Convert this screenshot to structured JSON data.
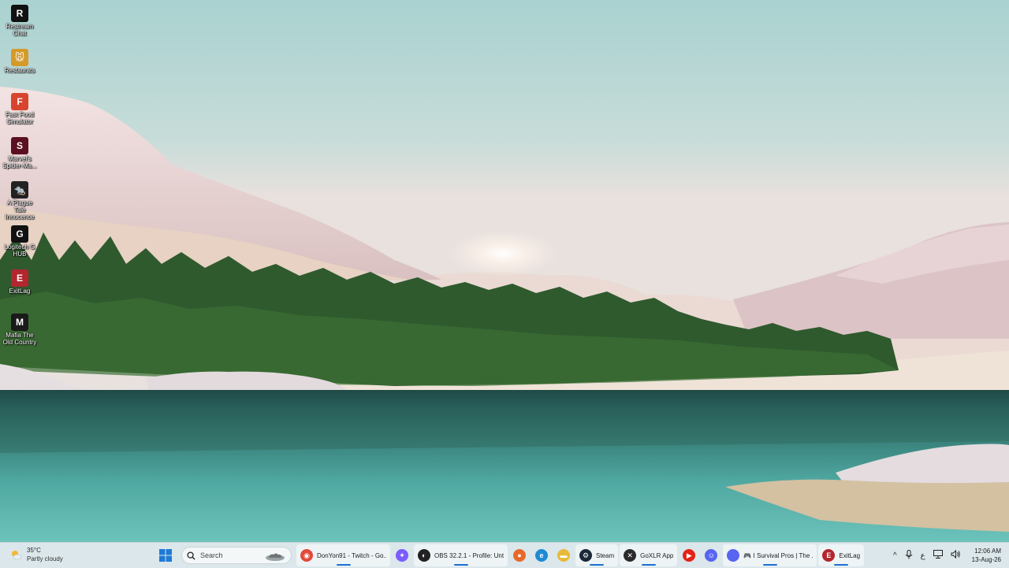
{
  "desktop": {
    "icons": [
      {
        "label": "Restream Chat",
        "icon": "restream-icon",
        "color": "#111111",
        "glyph": "R"
      },
      {
        "label": "Restaurats",
        "icon": "restaurats-icon",
        "color": "#d49a2a",
        "glyph": "🐭"
      },
      {
        "label": "Fast Food Simulator",
        "icon": "fast-food-simulator-icon",
        "color": "#d8452f",
        "glyph": "F"
      },
      {
        "label": "Marvel's Spider-Ma...",
        "icon": "spider-man-icon",
        "color": "#5a1020",
        "glyph": "S"
      },
      {
        "label": "A Plague Tale Innocence",
        "icon": "plague-tale-icon",
        "color": "#222222",
        "glyph": "🐀"
      },
      {
        "label": "Logitech G HUB",
        "icon": "logitech-ghub-icon",
        "color": "#111111",
        "glyph": "G"
      },
      {
        "label": "ExitLag",
        "icon": "exitlag-icon",
        "color": "#b3262d",
        "glyph": "E"
      },
      {
        "label": "Mafia The Old Country",
        "icon": "mafia-icon",
        "color": "#1a1a1a",
        "glyph": "M"
      }
    ]
  },
  "taskbar": {
    "weather": {
      "temp": "35°C",
      "condition": "Partly cloudy"
    },
    "search": {
      "placeholder": "Search"
    },
    "apps": [
      {
        "title": "DonYon91 - Twitch - Go...",
        "icon": "chrome-icon",
        "color": "#e04a3a",
        "glyph": "◉",
        "active": true
      },
      {
        "title": "",
        "icon": "copilot-icon",
        "color": "#7a5cff",
        "glyph": "✦",
        "active": false
      },
      {
        "title": "OBS 32.2.1 - Profile: Unt...",
        "icon": "obs-icon",
        "color": "#222222",
        "glyph": "◐",
        "active": true
      },
      {
        "title": "",
        "icon": "firefox-icon",
        "color": "#e8692a",
        "glyph": "●",
        "active": false
      },
      {
        "title": "",
        "icon": "edge-icon",
        "color": "#1f8ad3",
        "glyph": "e",
        "active": false
      },
      {
        "title": "",
        "icon": "file-explorer-icon",
        "color": "#e9b93a",
        "glyph": "▬",
        "active": false
      },
      {
        "title": "Steam",
        "icon": "steam-icon",
        "color": "#1b2838",
        "glyph": "⚙",
        "active": true
      },
      {
        "title": "GoXLR App",
        "icon": "goxlr-icon",
        "color": "#2b2b2b",
        "glyph": "✕",
        "active": true
      },
      {
        "title": "",
        "icon": "youtube-icon",
        "color": "#e62117",
        "glyph": "▶",
        "active": false
      },
      {
        "title": "",
        "icon": "discord-icon",
        "color": "#5865f2",
        "glyph": "☺",
        "active": false
      },
      {
        "title": "🎮 I Survival Pros | The ...",
        "icon": "discord-channel-icon",
        "color": "#5865f2",
        "glyph": "",
        "active": true
      },
      {
        "title": "ExitLag",
        "icon": "exitlag-taskbar-icon",
        "color": "#b3262d",
        "glyph": "E",
        "active": true
      }
    ],
    "tray": {
      "chevron": "^",
      "icons": [
        "microphone-icon",
        "keyboard-layout-icon",
        "network-icon",
        "volume-icon"
      ],
      "keyboard": "ع",
      "time": "12:06 AM",
      "date": "13-Aug-26"
    }
  }
}
